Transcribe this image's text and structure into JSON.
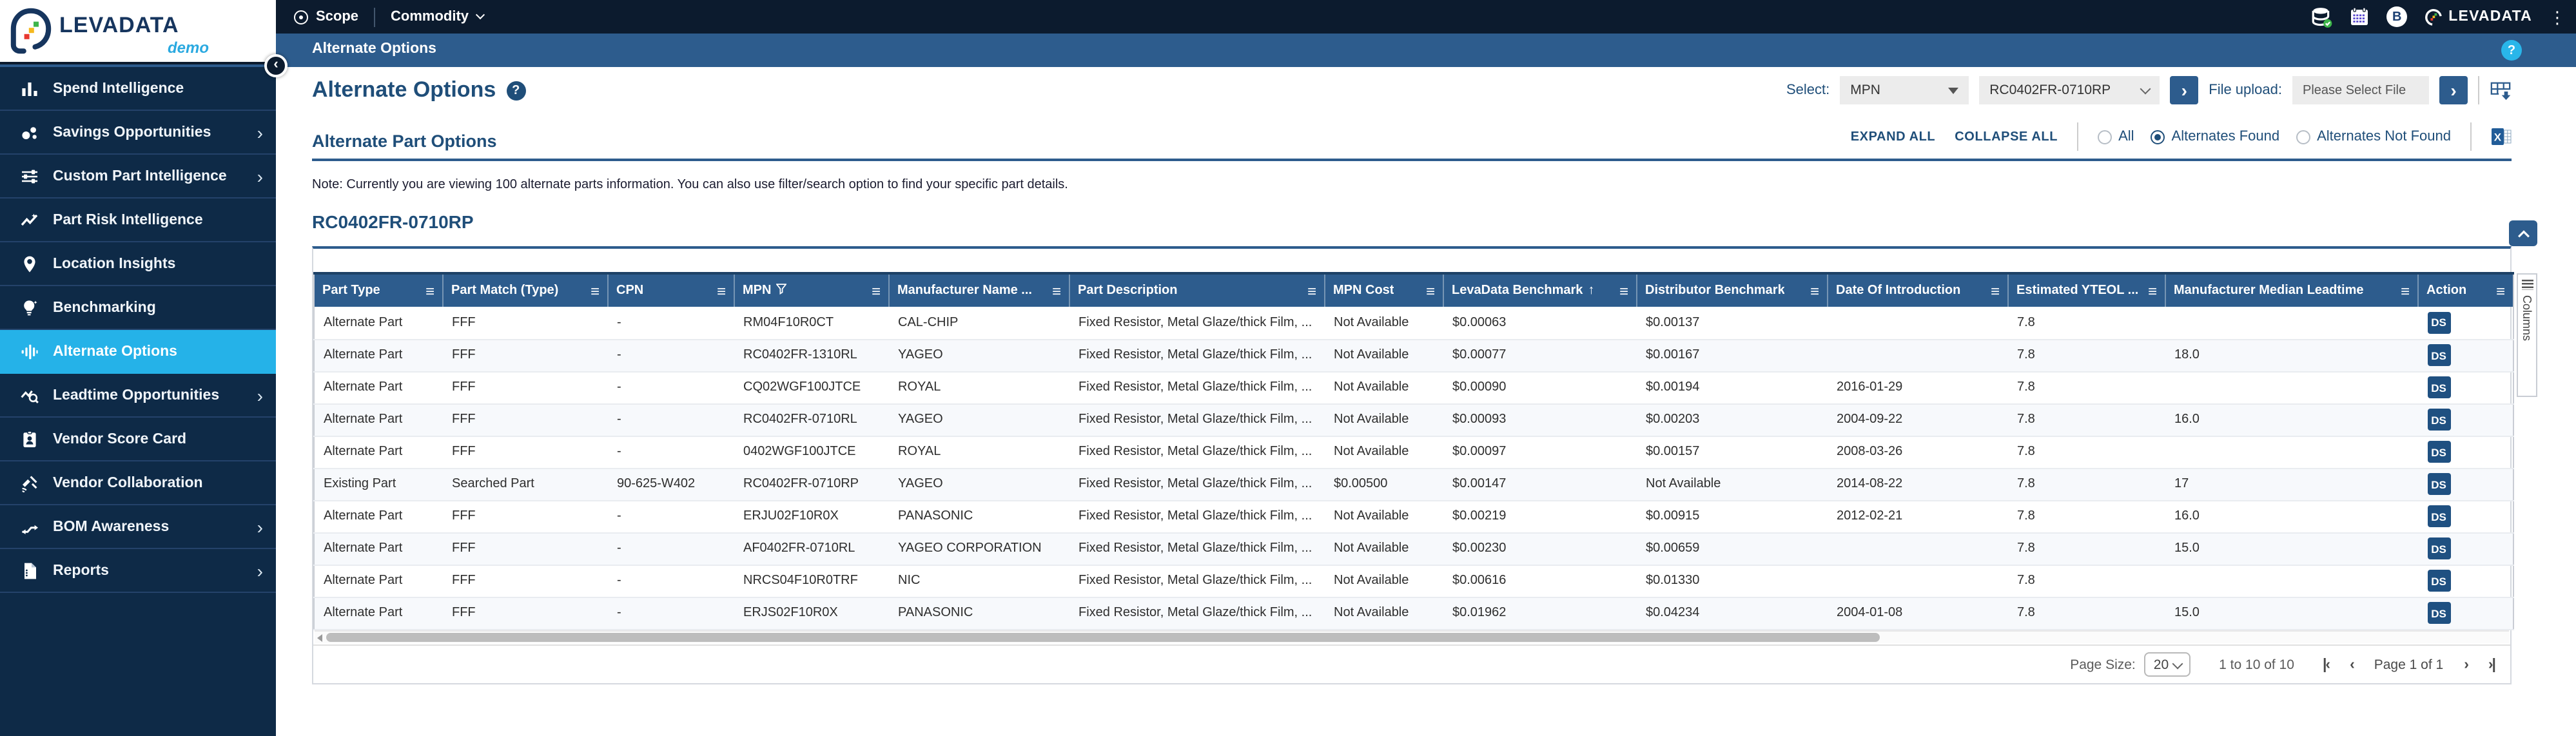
{
  "top_bar": {
    "logo_text": "LEVADATA",
    "logo_sub": "demo",
    "scope_label": "Scope",
    "commodity_label": "Commodity",
    "user_initial": "B",
    "brand_right": "LEVADATA"
  },
  "breadcrumb": {
    "title": "Alternate Options",
    "help_label": "?"
  },
  "sidebar": {
    "items": [
      {
        "label": "Spend Intelligence",
        "icon": "bar-chart",
        "submenu": false,
        "selected": false
      },
      {
        "label": "Savings Opportunities",
        "icon": "savings",
        "submenu": true,
        "selected": false
      },
      {
        "label": "Custom Part Intelligence",
        "icon": "sliders",
        "submenu": true,
        "selected": false
      },
      {
        "label": "Part Risk Intelligence",
        "icon": "risk-trend",
        "submenu": false,
        "selected": false
      },
      {
        "label": "Location Insights",
        "icon": "map-pin",
        "submenu": false,
        "selected": false
      },
      {
        "label": "Benchmarking",
        "icon": "lightbulb",
        "submenu": false,
        "selected": false
      },
      {
        "label": "Alternate Options",
        "icon": "equalizer",
        "submenu": false,
        "selected": true
      },
      {
        "label": "Leadtime Opportunities",
        "icon": "leadtime-search",
        "submenu": true,
        "selected": false
      },
      {
        "label": "Vendor Score Card",
        "icon": "id-card",
        "submenu": false,
        "selected": false
      },
      {
        "label": "Vendor Collaboration",
        "icon": "collaboration",
        "submenu": false,
        "selected": false
      },
      {
        "label": "BOM Awareness",
        "icon": "bom-flow",
        "submenu": true,
        "selected": false
      },
      {
        "label": "Reports",
        "icon": "report-doc",
        "submenu": true,
        "selected": false
      }
    ]
  },
  "header": {
    "title": "Alternate Options",
    "help_label": "?",
    "select_label": "Select:",
    "select_value": "MPN",
    "part_value": "RC0402FR-0710RP",
    "file_upload_label": "File upload:",
    "file_placeholder": "Please Select File"
  },
  "section": {
    "title": "Alternate Part Options",
    "expand_all": "EXPAND ALL",
    "collapse_all": "COLLAPSE ALL",
    "radios": [
      {
        "label": "All",
        "selected": false
      },
      {
        "label": "Alternates Found",
        "selected": true
      },
      {
        "label": "Alternates Not Found",
        "selected": false
      }
    ],
    "note": "Note: Currently you are viewing 100 alternate parts information. You can also use filter/search option to find your specific part details.",
    "part_heading": "RC0402FR-0710RP"
  },
  "table": {
    "columns_tab_label": "Columns",
    "action_label": "DS",
    "columns": [
      {
        "label": "Part Type",
        "key": "part_type",
        "w": 100,
        "filter": false,
        "sort": false
      },
      {
        "label": "Part Match (Type)",
        "key": "part_match",
        "w": 128,
        "filter": false,
        "sort": false
      },
      {
        "label": "CPN",
        "key": "cpn",
        "w": 98,
        "filter": false,
        "sort": false
      },
      {
        "label": "MPN",
        "key": "mpn",
        "w": 120,
        "filter": true,
        "sort": false
      },
      {
        "label": "Manufacturer Name ...",
        "key": "manufacturer",
        "w": 140,
        "filter": false,
        "sort": false
      },
      {
        "label": "Part Description",
        "key": "description",
        "w": 198,
        "filter": false,
        "sort": false
      },
      {
        "label": "MPN Cost",
        "key": "mpn_cost",
        "w": 92,
        "filter": false,
        "sort": false
      },
      {
        "label": "LevaData Benchmark",
        "key": "levadata",
        "w": 150,
        "filter": false,
        "sort": true
      },
      {
        "label": "Distributor Benchmark",
        "key": "distributor",
        "w": 148,
        "filter": false,
        "sort": false
      },
      {
        "label": "Date Of Introduction",
        "key": "date_intro",
        "w": 140,
        "filter": false,
        "sort": false
      },
      {
        "label": "Estimated YTEOL ...",
        "key": "yteol",
        "w": 122,
        "filter": false,
        "sort": false
      },
      {
        "label": "Manufacturer Median Leadtime",
        "key": "leadtime",
        "w": 196,
        "filter": false,
        "sort": false
      },
      {
        "label": "Action",
        "key": "action",
        "w": 74,
        "filter": false,
        "sort": false
      }
    ],
    "rows": [
      {
        "part_type": "Alternate Part",
        "part_match": "FFF",
        "cpn": "-",
        "mpn": "RM04F10R0CT",
        "manufacturer": "CAL-CHIP",
        "description": "Fixed Resistor, Metal Glaze/thick Film, ...",
        "mpn_cost": "Not Available",
        "levadata": "$0.00063",
        "distributor": "$0.00137",
        "dist_link": true,
        "date_intro": "",
        "yteol": "7.8",
        "leadtime": ""
      },
      {
        "part_type": "Alternate Part",
        "part_match": "FFF",
        "cpn": "-",
        "mpn": "RC0402FR-1310RL",
        "manufacturer": "YAGEO",
        "description": "Fixed Resistor, Metal Glaze/thick Film, ...",
        "mpn_cost": "Not Available",
        "levadata": "$0.00077",
        "distributor": "$0.00167",
        "dist_link": true,
        "date_intro": "",
        "yteol": "7.8",
        "leadtime": "18.0"
      },
      {
        "part_type": "Alternate Part",
        "part_match": "FFF",
        "cpn": "-",
        "mpn": "CQ02WGF100JTCE",
        "manufacturer": "ROYAL",
        "description": "Fixed Resistor, Metal Glaze/thick Film, ...",
        "mpn_cost": "Not Available",
        "levadata": "$0.00090",
        "distributor": "$0.00194",
        "dist_link": true,
        "date_intro": "2016-01-29",
        "yteol": "7.8",
        "leadtime": ""
      },
      {
        "part_type": "Alternate Part",
        "part_match": "FFF",
        "cpn": "-",
        "mpn": "RC0402FR-0710RL",
        "manufacturer": "YAGEO",
        "description": "Fixed Resistor, Metal Glaze/thick Film, ...",
        "mpn_cost": "Not Available",
        "levadata": "$0.00093",
        "distributor": "$0.00203",
        "dist_link": true,
        "date_intro": "2004-09-22",
        "yteol": "7.8",
        "leadtime": "16.0"
      },
      {
        "part_type": "Alternate Part",
        "part_match": "FFF",
        "cpn": "-",
        "mpn": "0402WGF100JTCE",
        "manufacturer": "ROYAL",
        "description": "Fixed Resistor, Metal Glaze/thick Film, ...",
        "mpn_cost": "Not Available",
        "levadata": "$0.00097",
        "distributor": "$0.00157",
        "dist_link": true,
        "date_intro": "2008-03-26",
        "yteol": "7.8",
        "leadtime": ""
      },
      {
        "part_type": "Existing Part",
        "part_match": "Searched Part",
        "cpn": "90-625-W402",
        "mpn": "RC0402FR-0710RP",
        "manufacturer": "YAGEO",
        "description": "Fixed Resistor, Metal Glaze/thick Film, ...",
        "mpn_cost": "$0.00500",
        "levadata": "$0.00147",
        "distributor": "Not Available",
        "dist_link": false,
        "date_intro": "2014-08-22",
        "yteol": "7.8",
        "leadtime": "17"
      },
      {
        "part_type": "Alternate Part",
        "part_match": "FFF",
        "cpn": "-",
        "mpn": "ERJU02F10R0X",
        "manufacturer": "PANASONIC",
        "description": "Fixed Resistor, Metal Glaze/thick Film, ...",
        "mpn_cost": "Not Available",
        "levadata": "$0.00219",
        "distributor": "$0.00915",
        "dist_link": true,
        "date_intro": "2012-02-21",
        "yteol": "7.8",
        "leadtime": "16.0"
      },
      {
        "part_type": "Alternate Part",
        "part_match": "FFF",
        "cpn": "-",
        "mpn": "AF0402FR-0710RL",
        "manufacturer": "YAGEO CORPORATION",
        "description": "Fixed Resistor, Metal Glaze/thick Film, ...",
        "mpn_cost": "Not Available",
        "levadata": "$0.00230",
        "distributor": "$0.00659",
        "dist_link": true,
        "date_intro": "",
        "yteol": "7.8",
        "leadtime": "15.0"
      },
      {
        "part_type": "Alternate Part",
        "part_match": "FFF",
        "cpn": "-",
        "mpn": "NRCS04F10R0TRF",
        "manufacturer": "NIC",
        "description": "Fixed Resistor, Metal Glaze/thick Film, ...",
        "mpn_cost": "Not Available",
        "levadata": "$0.00616",
        "distributor": "$0.01330",
        "dist_link": true,
        "date_intro": "",
        "yteol": "7.8",
        "leadtime": ""
      },
      {
        "part_type": "Alternate Part",
        "part_match": "FFF",
        "cpn": "-",
        "mpn": "ERJS02F10R0X",
        "manufacturer": "PANASONIC",
        "description": "Fixed Resistor, Metal Glaze/thick Film, ...",
        "mpn_cost": "Not Available",
        "levadata": "$0.01962",
        "distributor": "$0.04234",
        "dist_link": true,
        "date_intro": "2004-01-08",
        "yteol": "7.8",
        "leadtime": "15.0"
      }
    ]
  },
  "pagination": {
    "page_size_label": "Page Size:",
    "page_size_value": "20",
    "range_text": "1 to 10 of 10",
    "page_text": "Page 1 of 1"
  },
  "colors": {
    "dark_navy": "#0c1b2e",
    "sidebar_navy": "#0e2a47",
    "steel_blue": "#2d5c8d",
    "accent_cyan": "#25b2e8",
    "title_blue": "#1f4e79",
    "link_blue": "#2e6da4"
  }
}
